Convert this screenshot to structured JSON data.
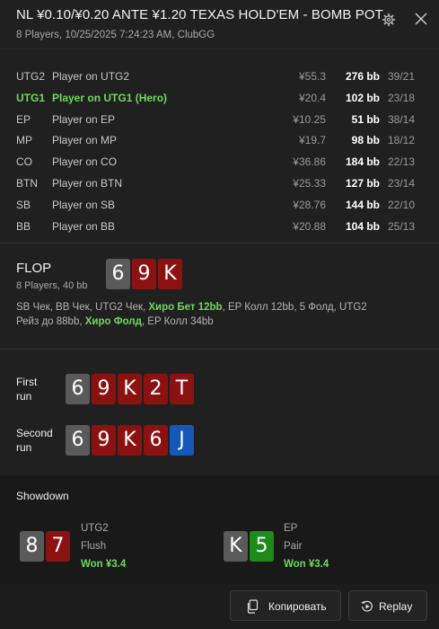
{
  "header": {
    "title": "NL ¥0.10/¥0.20 ANTE ¥1.20 TEXAS HOLD'EM - BOMB POT",
    "subtitle": "8 Players, 10/25/2025 7:24:23 AM, ClubGG",
    "settings_icon": "gear-icon",
    "close_icon": "close-icon"
  },
  "players": [
    {
      "pos": "UTG2",
      "name": "Player on UTG2",
      "stack": "¥55.3",
      "bb": "276 bb",
      "stat": "39/21",
      "hero": false
    },
    {
      "pos": "UTG1",
      "name": "Player on UTG1 (Hero)",
      "stack": "¥20.4",
      "bb": "102 bb",
      "stat": "23/18",
      "hero": true
    },
    {
      "pos": "EP",
      "name": "Player on EP",
      "stack": "¥10.25",
      "bb": "51 bb",
      "stat": "38/14",
      "hero": false
    },
    {
      "pos": "MP",
      "name": "Player on MP",
      "stack": "¥19.7",
      "bb": "98 bb",
      "stat": "18/12",
      "hero": false
    },
    {
      "pos": "CO",
      "name": "Player on CO",
      "stack": "¥36.86",
      "bb": "184 bb",
      "stat": "22/13",
      "hero": false
    },
    {
      "pos": "BTN",
      "name": "Player on BTN",
      "stack": "¥25.33",
      "bb": "127 bb",
      "stat": "23/14",
      "hero": false
    },
    {
      "pos": "SB",
      "name": "Player on SB",
      "stack": "¥28.76",
      "bb": "144 bb",
      "stat": "22/10",
      "hero": false
    },
    {
      "pos": "BB",
      "name": "Player on BB",
      "stack": "¥20.88",
      "bb": "104 bb",
      "stat": "25/13",
      "hero": false
    }
  ],
  "flop": {
    "label": "FLOP",
    "sub": "8 Players, 40 bb",
    "cards": [
      {
        "rank": "6",
        "color": "gray"
      },
      {
        "rank": "9",
        "color": "red"
      },
      {
        "rank": "K",
        "color": "red"
      }
    ],
    "actions": {
      "a1": "SB Чек, BB Чек, UTG2 Чек, ",
      "a2": "Хиро Бет 12bb",
      "a3": ", EP Колл 12bb, 5 Фолд, UTG2 Рейз до 88bb, ",
      "a4": "Хиро Фолд",
      "a5": ", EP Колл 34bb"
    }
  },
  "runs": [
    {
      "label": "First run",
      "label_line1": "First",
      "label_line2": "run",
      "cards": [
        {
          "rank": "6",
          "color": "gray"
        },
        {
          "rank": "9",
          "color": "red"
        },
        {
          "rank": "K",
          "color": "red"
        },
        {
          "rank": "2",
          "color": "red"
        },
        {
          "rank": "T",
          "color": "red"
        }
      ]
    },
    {
      "label": "Second run",
      "label_line1": "Second",
      "label_line2": "run",
      "cards": [
        {
          "rank": "6",
          "color": "gray"
        },
        {
          "rank": "9",
          "color": "red"
        },
        {
          "rank": "K",
          "color": "red"
        },
        {
          "rank": "6",
          "color": "red"
        },
        {
          "rank": "J",
          "color": "blue"
        }
      ]
    }
  ],
  "showdown": {
    "label": "Showdown",
    "hands": [
      {
        "cards": [
          {
            "rank": "8",
            "color": "gray"
          },
          {
            "rank": "7",
            "color": "red"
          }
        ],
        "pos": "UTG2",
        "hand": "Flush",
        "won": "Won ¥3.4"
      },
      {
        "cards": [
          {
            "rank": "K",
            "color": "gray"
          },
          {
            "rank": "5",
            "color": "green"
          }
        ],
        "pos": "EP",
        "hand": "Pair",
        "won": "Won ¥3.4"
      }
    ]
  },
  "footer": {
    "copy_label": "Копировать",
    "copy_icon": "copy-icon",
    "replay_label": "Replay",
    "replay_icon": "replay-icon"
  },
  "colors": {
    "background": "#202020",
    "hero_green": "#6fd85d",
    "card_gray": "#5a5a5a",
    "card_red": "#8c1212",
    "card_blue": "#1558b8",
    "card_green": "#1d8a1a"
  }
}
